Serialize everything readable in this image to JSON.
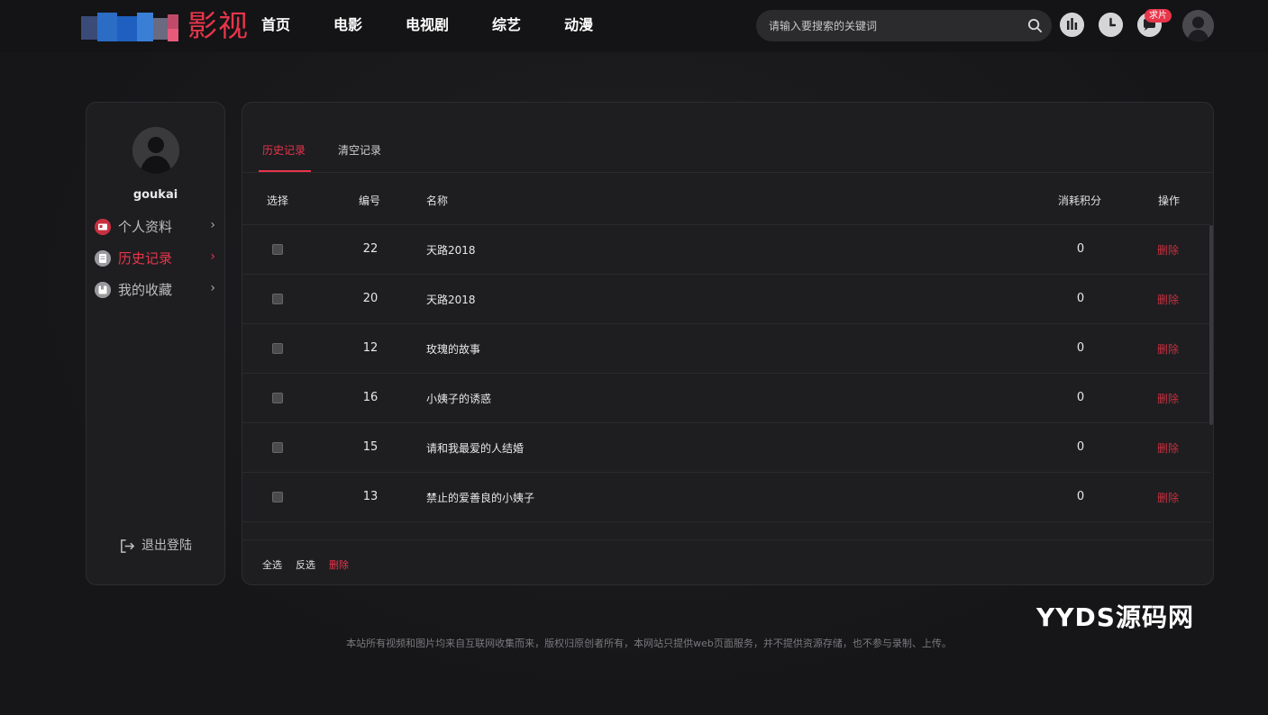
{
  "header": {
    "logo_text": "影视",
    "nav": [
      "首页",
      "电影",
      "电视剧",
      "综艺",
      "动漫"
    ],
    "search_placeholder": "请输入要搜索的关键词",
    "badge": "求片"
  },
  "sidebar": {
    "username": "goukai",
    "items": [
      {
        "label": "个人资料",
        "arrow": "›"
      },
      {
        "label": "历史记录",
        "arrow": "›"
      },
      {
        "label": "我的收藏",
        "arrow": "›"
      }
    ],
    "logout_label": "退出登陆"
  },
  "main": {
    "tabs": [
      "历史记录",
      "清空记录"
    ],
    "columns": [
      "选择",
      "编号",
      "名称",
      "消耗积分",
      "操作"
    ],
    "rows": [
      {
        "id": "22",
        "name": "天路2018",
        "points": "0",
        "action": "删除"
      },
      {
        "id": "20",
        "name": "天路2018",
        "points": "0",
        "action": "删除"
      },
      {
        "id": "12",
        "name": "玫瑰的故事",
        "points": "0",
        "action": "删除"
      },
      {
        "id": "16",
        "name": "小姨子的诱惑",
        "points": "0",
        "action": "删除"
      },
      {
        "id": "15",
        "name": "请和我最爱的人结婚",
        "points": "0",
        "action": "删除"
      },
      {
        "id": "13",
        "name": "禁止的爱善良的小姨子",
        "points": "0",
        "action": "删除"
      }
    ],
    "footer_actions": [
      "全选",
      "反选",
      "删除"
    ]
  },
  "watermark": "YYDS源码网",
  "copyright": "本站所有视频和图片均来自互联网收集而来，版权归原创者所有，本网站只提供web页面服务，并不提供资源存储，也不参与录制、上传。",
  "colors": {
    "accent": "#e8354a",
    "background": "#171719",
    "panel": "#1e1e21"
  }
}
